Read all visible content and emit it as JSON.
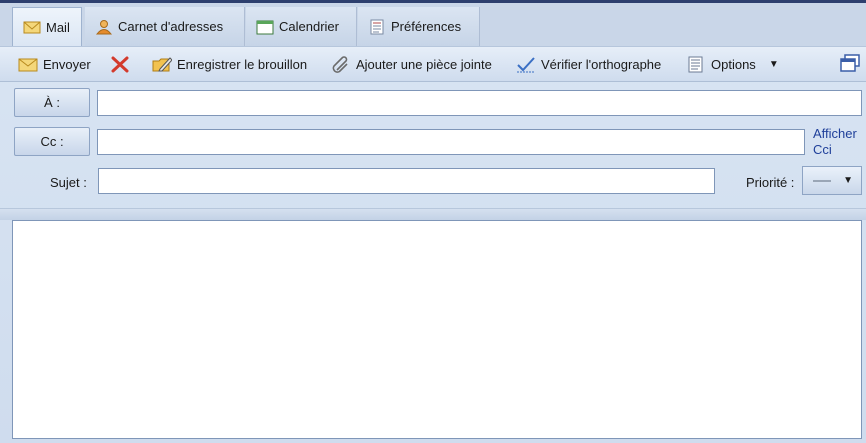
{
  "tabs": [
    {
      "label": "Mail",
      "icon": "envelope-icon",
      "active": true
    },
    {
      "label": "Carnet d'adresses",
      "icon": "contact-person-icon"
    },
    {
      "label": "Calendrier",
      "icon": "calendar-icon"
    },
    {
      "label": "Préférences",
      "icon": "preferences-icon"
    }
  ],
  "toolbar": {
    "send_label": "Envoyer",
    "discard_icon": "red-x-icon",
    "save_draft_label": "Enregistrer le brouillon",
    "attach_label": "Ajouter une pièce jointe",
    "spellcheck_label": "Vérifier l'orthographe",
    "options_label": "Options",
    "restore_icon": "window-restore-icon"
  },
  "form": {
    "to_label": "À :",
    "to_value": "",
    "cc_label": "Cc :",
    "cc_value": "",
    "show_bcc_link": "Afficher Cci",
    "subject_label": "Sujet :",
    "subject_value": "",
    "priority_label": "Priorité :",
    "priority_value": "—"
  },
  "message_body": "",
  "colors": {
    "link": "#1f3f9a",
    "field_border": "#7f96b8",
    "chrome": "#cfdcee",
    "discard_red": "#d33a2c"
  }
}
